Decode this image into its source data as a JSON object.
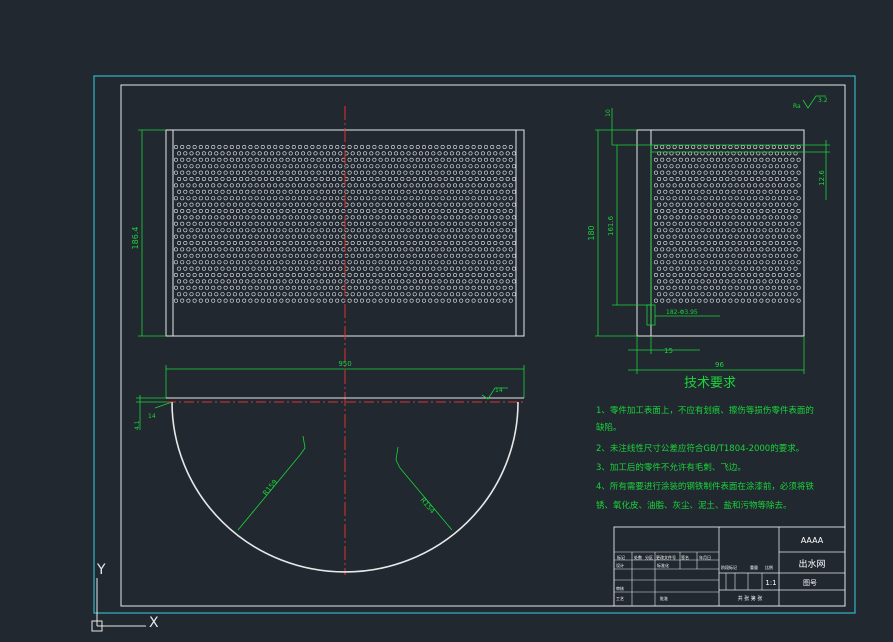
{
  "drawing": {
    "tech_req": {
      "title": "技术要求",
      "items": [
        "1、零件加工表面上，不应有划痕、擦伤等损伤零件表面的",
        "缺陷。",
        "2、未注线性尺寸公差应符合GB/T1804-2000的要求。",
        "3、加工后的零件不允许有毛刺、飞边。",
        "4、所有需要进行涂装的钢铁制件表面在涂漆前，必须将铁",
        "锈、氧化皮、油脂、灰尘、泥土、盐和污物等除去。"
      ]
    },
    "dims": {
      "width_top": "950",
      "left_height": "186.4",
      "right_height": "180",
      "right_inner_height": "161.6",
      "right_small": "12.6",
      "right_small_vert": "10",
      "right_bottom_hole": "182-Φ3.95",
      "right_bottom_a": "15",
      "right_bottom_b": "96",
      "radius_1": "R159",
      "radius_2": "R154",
      "lip": "14",
      "lip_vert": "4.1",
      "weld_top": "14",
      "roughness": "3.2",
      "roughness_label": "Ra"
    },
    "title_block": {
      "company": "AAAA",
      "part_name": "出水网",
      "drawing_no": "图号",
      "scale": "1:1",
      "sheet": "共 张 第 张",
      "cells": [
        "标记",
        "处数",
        "分区",
        "更改文件号",
        "签名",
        "年月日",
        "设计",
        "标准化",
        "审核",
        "工艺",
        "批准",
        "阶段标记",
        "重量",
        "比例"
      ]
    },
    "ucs": {
      "x_label": "X",
      "y_label": "Y"
    }
  }
}
